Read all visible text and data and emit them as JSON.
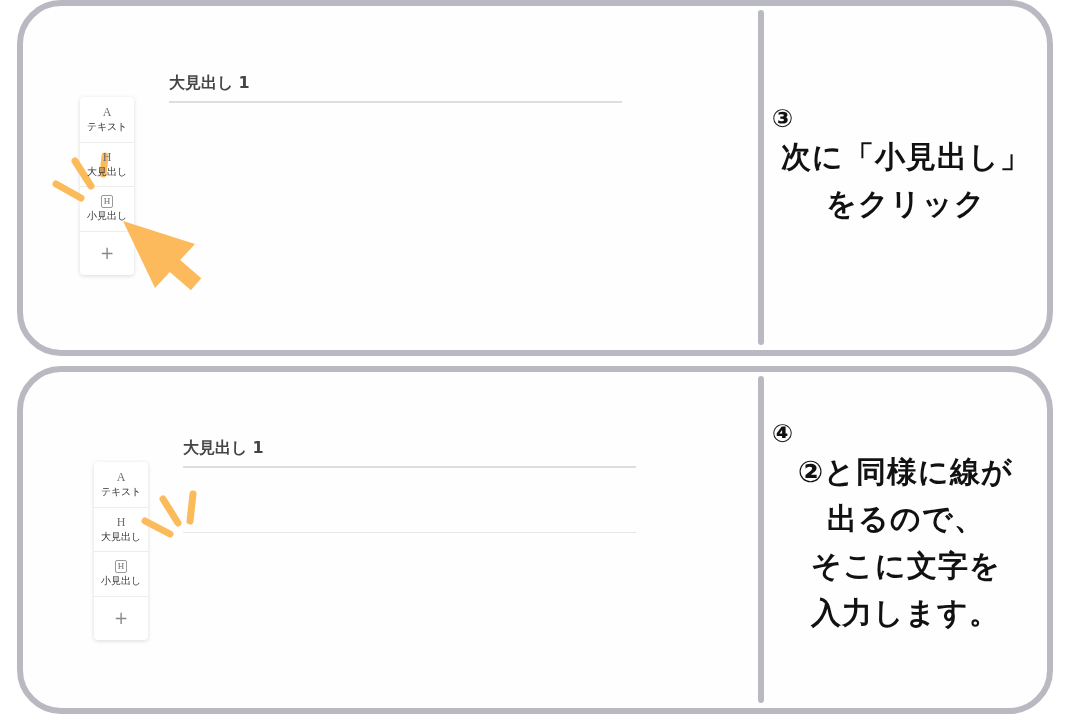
{
  "panels": [
    {
      "editor": {
        "heading": "大見出し 1",
        "toolbar": [
          {
            "kind": "letter",
            "glyph": "A",
            "label": "テキスト"
          },
          {
            "kind": "letter",
            "glyph": "H",
            "label": "大見出し"
          },
          {
            "kind": "boxed",
            "glyph": "H",
            "label": "小見出し",
            "click_mark": true,
            "pointer": true
          },
          {
            "kind": "add",
            "glyph": "+"
          }
        ]
      },
      "step": "③",
      "instruction": [
        "次に「小見出し」",
        "をクリック"
      ]
    },
    {
      "editor": {
        "heading": "大見出し 1",
        "input_line": true,
        "toolbar": [
          {
            "kind": "letter",
            "glyph": "A",
            "label": "テキスト"
          },
          {
            "kind": "letter",
            "glyph": "H",
            "label": "大見出し",
            "click_mark": true
          },
          {
            "kind": "boxed",
            "glyph": "H",
            "label": "小見出し"
          },
          {
            "kind": "add",
            "glyph": "+"
          }
        ]
      },
      "step": "④",
      "instruction": [
        "②と同様に線が",
        "出るので、",
        "そこに文字を",
        "入力します。"
      ]
    }
  ]
}
